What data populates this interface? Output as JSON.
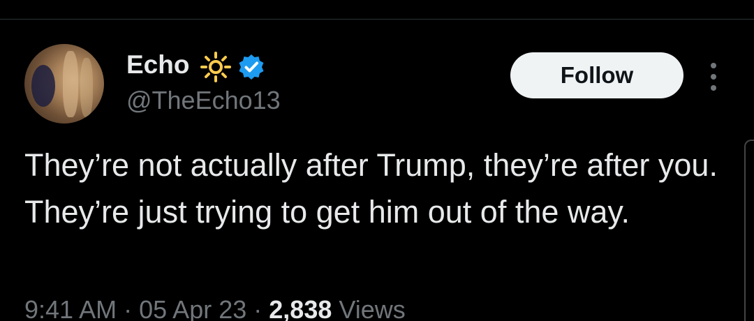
{
  "tweet": {
    "author": {
      "display_name": "Echo",
      "handle": "@TheEcho13",
      "verified": true,
      "badge_emoji_icon": "sun-icon"
    },
    "follow_label": "Follow",
    "more_icon": "more-vertical-icon",
    "text": "They’re not actually after Trump, they’re after you. They’re just trying to get him out of the way.",
    "time": "9:41 AM",
    "separator": "·",
    "date": "05 Apr 23",
    "views_count": "2,838",
    "views_label": "Views"
  },
  "colors": {
    "background": "#000000",
    "text_primary": "#e7e9ea",
    "text_secondary": "#71767b",
    "verified_blue": "#1d9bf0",
    "sun_yellow": "#ffcc4d",
    "follow_bg": "#eff3f4"
  }
}
